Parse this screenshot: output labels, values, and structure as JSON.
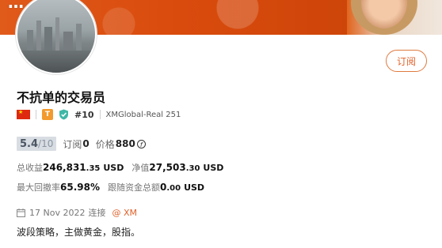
{
  "banner": {
    "text": "…",
    "brand_color": "#d94b0d"
  },
  "profile": {
    "subscribe_label": "订阅",
    "name": "不抗单的交易员",
    "country_icon": "china-flag-icon",
    "level_badge": "T",
    "verified_icon": "shield-check-icon",
    "rank": "#10",
    "server": "XMGlobal-Real 251"
  },
  "score": {
    "value": "5.4",
    "separator": "/",
    "max": "10",
    "subscribers_label": "订阅",
    "subscribers_value": "0",
    "price_label": "价格",
    "price_value": "880",
    "currency_icon": "coin-icon"
  },
  "metrics": {
    "total_profit_label": "总收益",
    "total_profit_int": "246,831",
    "total_profit_dec": ".35",
    "total_profit_unit": "USD",
    "equity_label": "净值",
    "equity_int": "27,503",
    "equity_dec": ".30",
    "equity_unit": "USD",
    "max_drawdown_label": "最大回撤率",
    "max_drawdown_value": "65.98%",
    "follow_funds_label": "跟随资金总额",
    "follow_funds_int": "0",
    "follow_funds_dec": ".00",
    "follow_funds_unit": "USD"
  },
  "connection": {
    "date": "17 Nov 2022",
    "label": "连接",
    "broker_prefix": "@",
    "broker": "XM",
    "accent_color": "#e0622a"
  },
  "description": "波段策略，主做黄金，股指。"
}
